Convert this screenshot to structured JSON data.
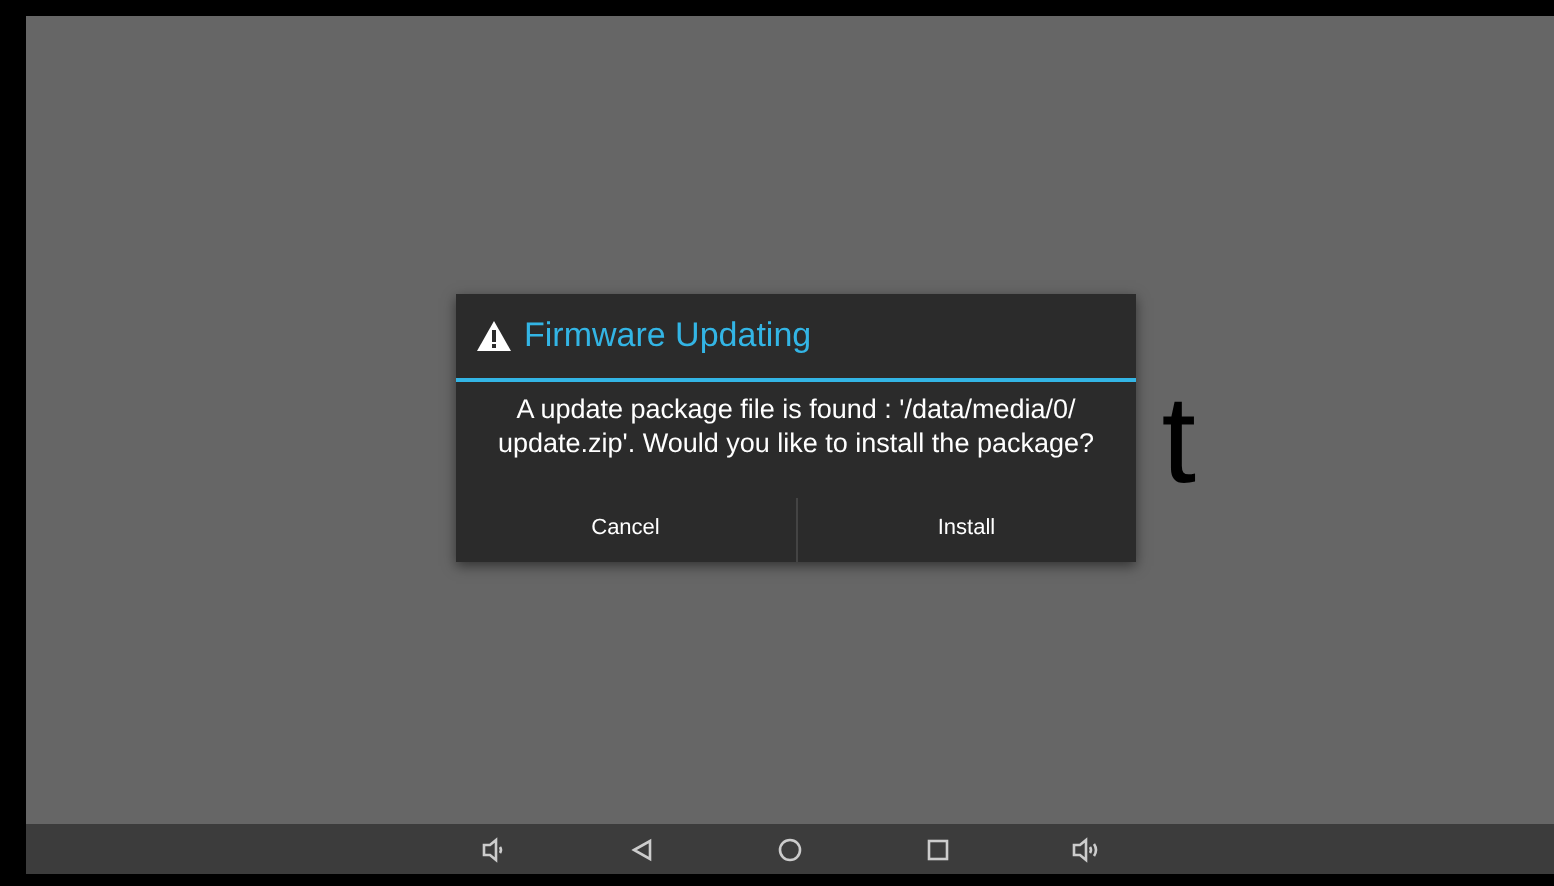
{
  "background_text": {
    "right_fragment": "t"
  },
  "dialog": {
    "title": "Firmware Updating",
    "message": "A update package file is found : '/data/media/0/ update.zip'. Would you like to install the package?",
    "buttons": [
      "Cancel",
      "Install"
    ]
  },
  "nav_bar": {
    "buttons": [
      {
        "kind": "volume-down"
      },
      {
        "kind": "back"
      },
      {
        "kind": "home"
      },
      {
        "kind": "recents"
      },
      {
        "kind": "volume-up"
      }
    ]
  }
}
